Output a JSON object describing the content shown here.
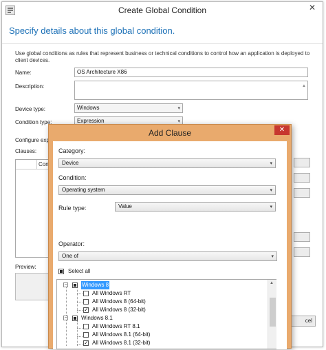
{
  "outer": {
    "title": "Create Global Condition",
    "close_glyph": "✕",
    "heading": "Specify details about this global condition.",
    "description": "Use global conditions as rules that represent business or technical conditions to control how an application is deployed to client devices.",
    "name_label": "Name:",
    "name_value": "OS Architecture X86",
    "description_label": "Description:",
    "device_type_label": "Device type:",
    "device_type_value": "Windows",
    "condition_type_label": "Condition type:",
    "condition_type_value": "Expression",
    "configure_label": "Configure exp",
    "clauses_label": "Clauses:",
    "clauses_col": "Con",
    "preview_label": "Preview:",
    "cancel_label": "cel"
  },
  "dialog": {
    "title": "Add Clause",
    "close_glyph": "✕",
    "category_label": "Category:",
    "category_value": "Device",
    "condition_label": "Condition:",
    "condition_value": "Operating system",
    "rule_type_label": "Rule type:",
    "rule_type_value": "Value",
    "operator_label": "Operator:",
    "operator_value": "One of",
    "select_all_label": "Select all",
    "tree": {
      "group1": {
        "label": "Windows 8",
        "items": [
          "All Windows RT",
          "All Windows 8 (64-bit)",
          "All Windows 8 (32-bit)"
        ]
      },
      "group2": {
        "label": "Windows 8.1",
        "items": [
          "All Windows RT 8.1",
          "All Windows 8.1 (64-bit)",
          "All Windows 8.1 (32-bit)"
        ]
      }
    }
  },
  "icons": {
    "dropdown": "▾",
    "expand_minus": "−",
    "scroll_up": "▲"
  }
}
